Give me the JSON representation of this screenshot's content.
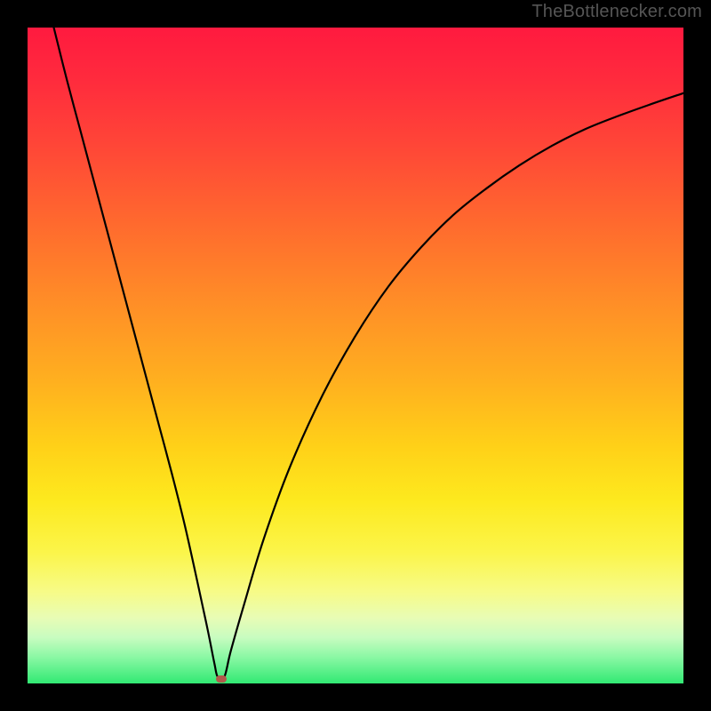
{
  "attribution": "TheBottlenecker.com",
  "chart_data": {
    "type": "line",
    "title": "",
    "xlabel": "",
    "ylabel": "",
    "xlim": [
      0,
      100
    ],
    "ylim": [
      0,
      100
    ],
    "x": [
      4,
      6,
      8,
      10,
      12,
      14,
      16,
      18,
      20,
      22,
      24,
      26,
      27.5,
      28.5,
      29,
      30,
      31,
      33,
      36,
      40,
      45,
      50,
      55,
      60,
      65,
      70,
      75,
      80,
      85,
      90,
      95,
      100
    ],
    "values": [
      100,
      92,
      84.5,
      77,
      69.5,
      62,
      54.5,
      47,
      39.5,
      32,
      24,
      15,
      8,
      3,
      1,
      1,
      5,
      12,
      22,
      33,
      44,
      53,
      60.5,
      66.5,
      71.5,
      75.5,
      79,
      82,
      84.5,
      86.5,
      88.3,
      90
    ],
    "marker": {
      "x": 29.5,
      "y": 1
    },
    "gradient_colors": {
      "top": "#ff1a3f",
      "mid_upper": "#ff8e27",
      "mid": "#fde91e",
      "mid_lower": "#c8fcc0",
      "bottom": "#31e973"
    }
  }
}
